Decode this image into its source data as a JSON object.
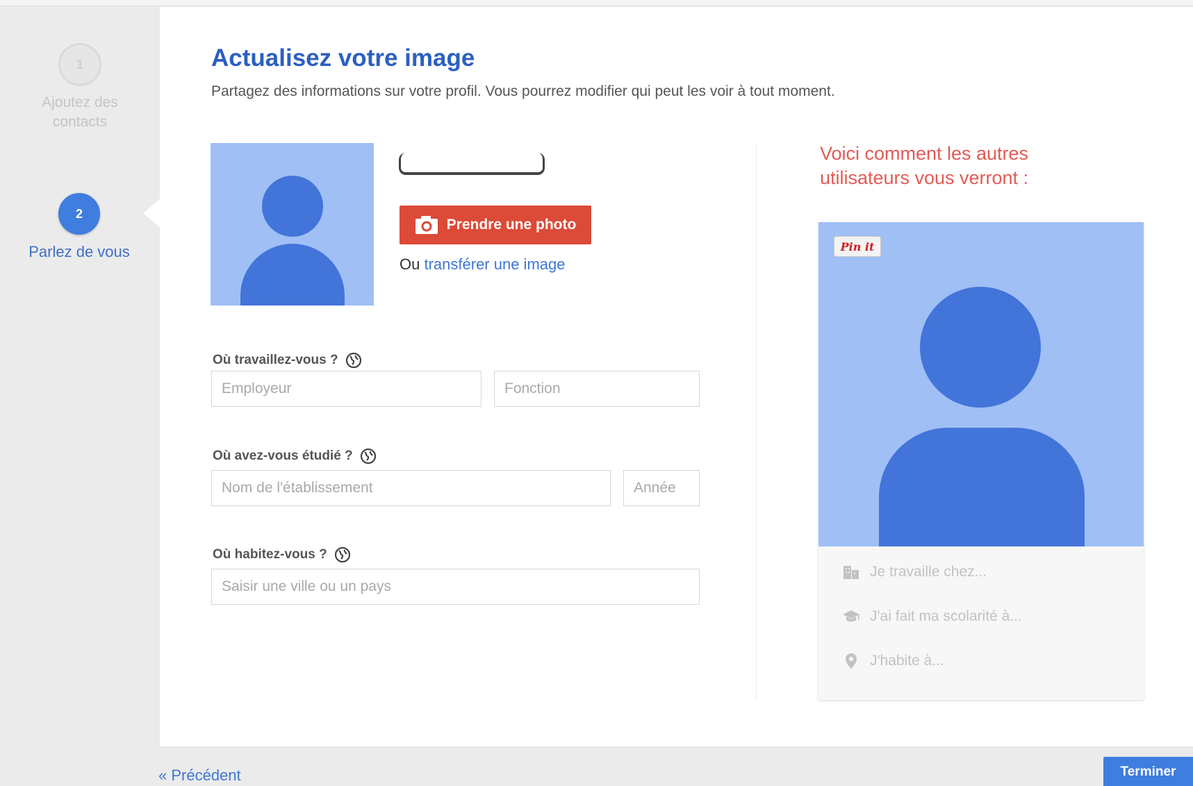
{
  "stepper": {
    "steps": [
      {
        "number": "1",
        "label": "Ajoutez des contacts",
        "state": "done"
      },
      {
        "number": "2",
        "label": "Parlez de vous",
        "state": "active"
      }
    ]
  },
  "header": {
    "title": "Actualisez votre image",
    "subtitle": "Partagez des informations sur votre profil. Vous pourrez modifier qui peut les voir à tout moment."
  },
  "photo": {
    "take_photo_label": "Prendre une photo",
    "upload_prefix": "Ou",
    "upload_link": "transférer une image",
    "icon": "camera-icon"
  },
  "form": {
    "work": {
      "label": "Où travaillez-vous ?",
      "employer_placeholder": "Employeur",
      "role_placeholder": "Fonction"
    },
    "education": {
      "label": "Où avez-vous étudié ?",
      "school_placeholder": "Nom de l'établissement",
      "year_placeholder": "Année"
    },
    "location": {
      "label": "Où habitez-vous ?",
      "city_placeholder": "Saisir une ville ou un pays"
    },
    "visibility_icon": "globe-icon"
  },
  "preview": {
    "heading": "Voici comment les autres utilisateurs vous verront :",
    "pin_label": "Pin it",
    "rows": [
      {
        "icon": "building-icon",
        "text": "Je travaille chez..."
      },
      {
        "icon": "graduation-cap-icon",
        "text": "J'ai fait ma scolarité à..."
      },
      {
        "icon": "map-pin-icon",
        "text": "J'habite à..."
      }
    ]
  },
  "footer": {
    "previous_label": "« Précédent",
    "finish_label": "Terminer"
  },
  "colors": {
    "accent_blue": "#3f7ddf",
    "title_blue": "#2c5fc1",
    "button_red": "#dc4a38",
    "preview_heading_red": "#e25b55",
    "avatar_light": "#9fbff5",
    "avatar_dark": "#4274d9"
  }
}
